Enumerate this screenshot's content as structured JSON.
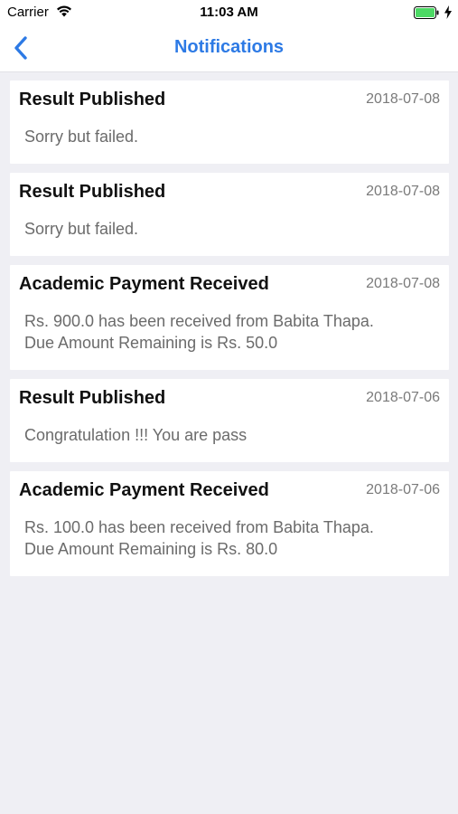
{
  "status_bar": {
    "carrier": "Carrier",
    "time": "11:03 AM",
    "icons": [
      "wifi-icon",
      "battery-icon",
      "charging-bolt-icon"
    ],
    "battery_color": "#4cd964"
  },
  "nav": {
    "title": "Notifications",
    "back_icon": "chevron-left-icon",
    "accent_color": "#2d7ae5"
  },
  "notifications": [
    {
      "title": "Result Published",
      "date": "2018-07-08",
      "message": "Sorry but failed."
    },
    {
      "title": "Result Published",
      "date": "2018-07-08",
      "message": "Sorry but failed."
    },
    {
      "title": "Academic Payment Received",
      "date": "2018-07-08",
      "message": "Rs. 900.0 has been received from Babita Thapa.\nDue Amount Remaining is Rs. 50.0"
    },
    {
      "title": "Result Published",
      "date": "2018-07-06",
      "message": "Congratulation !!! You are pass"
    },
    {
      "title": "Academic Payment Received",
      "date": "2018-07-06",
      "message": "Rs. 100.0 has been received from Babita Thapa.\nDue Amount Remaining is Rs. 80.0"
    }
  ]
}
